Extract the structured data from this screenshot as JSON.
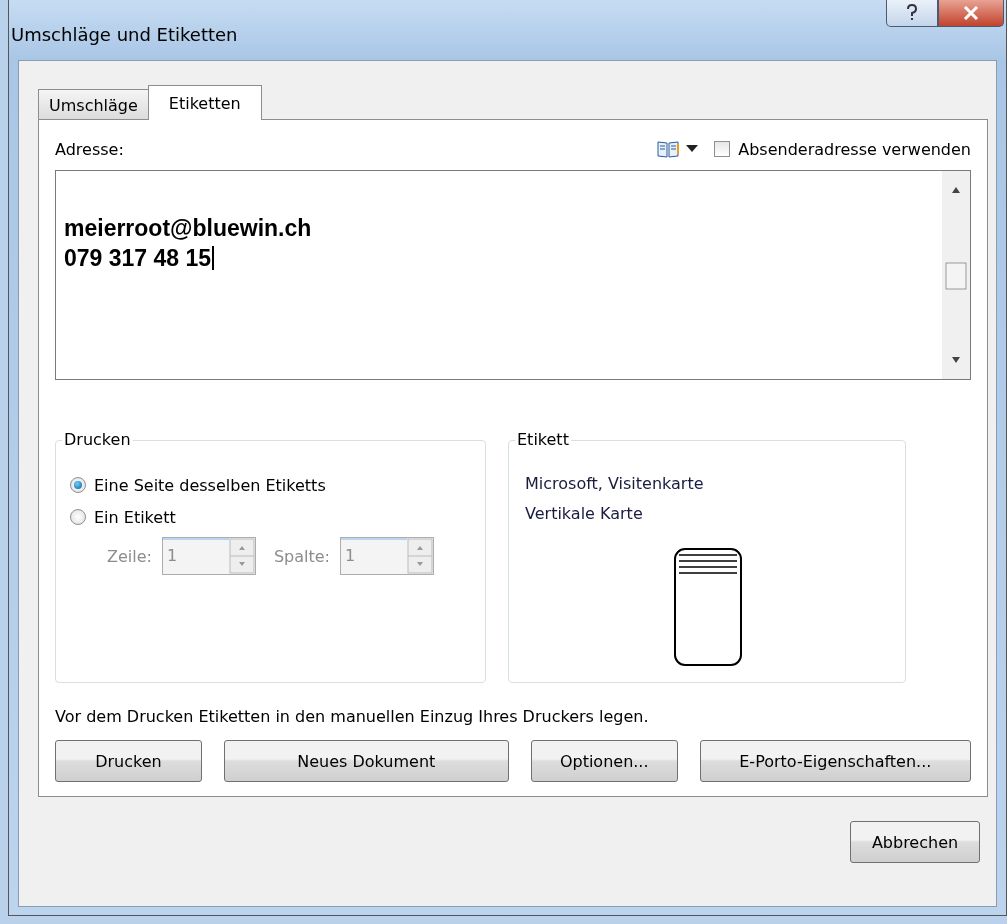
{
  "window": {
    "title": "Umschläge und Etiketten"
  },
  "tabs": [
    {
      "label": "Umschläge",
      "selected": false
    },
    {
      "label": "Etiketten",
      "selected": true
    }
  ],
  "address": {
    "label": "Adresse:",
    "lines": [
      "meierroot@bluewin.ch",
      "079 317 48 15"
    ],
    "use_sender_address": {
      "label": "Absenderadresse verwenden",
      "checked": false
    }
  },
  "print_group": {
    "title": "Drucken",
    "options": [
      {
        "label": "Eine Seite desselben Etiketts",
        "selected": true
      },
      {
        "label": "Ein Etikett",
        "selected": false
      }
    ],
    "fields": [
      {
        "label": "Zeile:",
        "value": "1",
        "disabled": true
      },
      {
        "label": "Spalte:",
        "value": "1",
        "disabled": true
      }
    ]
  },
  "label_group": {
    "title": "Etikett",
    "lines": [
      "Microsoft, Visitenkarte",
      "Vertikale Karte"
    ]
  },
  "note": "Vor dem Drucken Etiketten in den manuellen Einzug Ihres Druckers legen.",
  "buttons": [
    "Drucken",
    "Neues Dokument",
    "Optionen...",
    "E-Porto-Eigenschaften..."
  ],
  "footer_buttons": [
    "Abbrechen"
  ]
}
